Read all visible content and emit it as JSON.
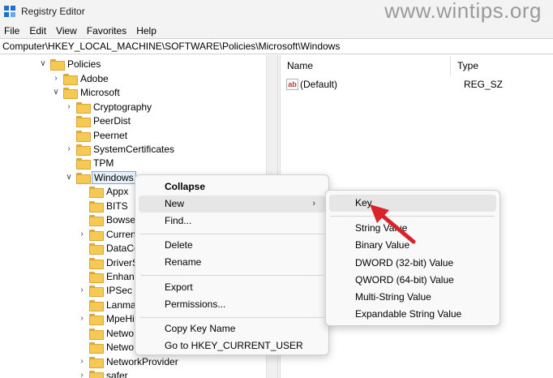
{
  "window": {
    "title": "Registry Editor",
    "icon": "registry-editor-icon"
  },
  "watermark": "www.wintips.org",
  "menubar": [
    "File",
    "Edit",
    "View",
    "Favorites",
    "Help"
  ],
  "address": "Computer\\HKEY_LOCAL_MACHINE\\SOFTWARE\\Policies\\Microsoft\\Windows",
  "tree": [
    {
      "label": "Policies",
      "chevron": "v"
    },
    {
      "label": "Adobe",
      "chevron": ">"
    },
    {
      "label": "Microsoft",
      "chevron": "v"
    },
    {
      "label": "Cryptography",
      "chevron": ">"
    },
    {
      "label": "PeerDist",
      "chevron": ""
    },
    {
      "label": "Peernet",
      "chevron": ""
    },
    {
      "label": "SystemCertificates",
      "chevron": ">"
    },
    {
      "label": "TPM",
      "chevron": ""
    },
    {
      "label": "Windows",
      "chevron": "v",
      "selected": true
    },
    {
      "label": "Appx",
      "chevron": ""
    },
    {
      "label": "BITS",
      "chevron": ""
    },
    {
      "label": "Bowse",
      "chevron": ""
    },
    {
      "label": "Curren",
      "chevron": ">"
    },
    {
      "label": "DataCo",
      "chevron": ""
    },
    {
      "label": "DriverS",
      "chevron": ""
    },
    {
      "label": "Enhanc",
      "chevron": ""
    },
    {
      "label": "IPSec",
      "chevron": ">"
    },
    {
      "label": "Lanma",
      "chevron": ""
    },
    {
      "label": "MpeHi",
      "chevron": ">"
    },
    {
      "label": "Netwo",
      "chevron": ""
    },
    {
      "label": "Netwo",
      "chevron": ""
    },
    {
      "label": "NetworkProvider",
      "chevron": ">"
    },
    {
      "label": "safer",
      "chevron": ">"
    }
  ],
  "values": {
    "columns": {
      "name": "Name",
      "type": "Type"
    },
    "rows": [
      {
        "icon": "ab",
        "name": "(Default)",
        "type": "REG_SZ"
      }
    ]
  },
  "context_menu": {
    "items": [
      "Collapse",
      "New",
      "Find...",
      "Delete",
      "Rename",
      "Export",
      "Permissions...",
      "Copy Key Name",
      "Go to HKEY_CURRENT_USER"
    ],
    "arrow": ">"
  },
  "submenu": {
    "items": [
      "Key",
      "String Value",
      "Binary Value",
      "DWORD (32-bit) Value",
      "QWORD (64-bit) Value",
      "Multi-String Value",
      "Expandable String Value"
    ]
  },
  "colors": {
    "arrow": "#d8232a",
    "folder": "#f6c955",
    "selection": "#e5f0fb"
  }
}
